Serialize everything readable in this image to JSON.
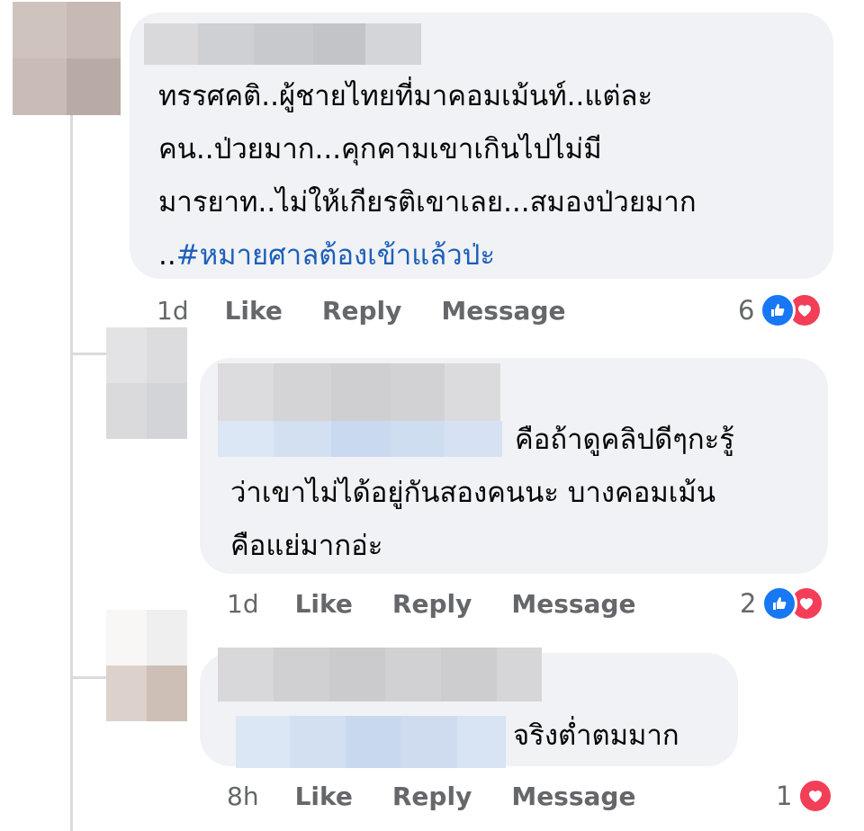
{
  "comments": [
    {
      "text": "ทรรศคติ..ผู้ชายไทยที่มาคอมเม้นท์..แต่ละ\nคน..ป่วยมาก...คุกคามเขาเกินไปไม่มี\nมารยาท..ไม่ให้เกียรติเขาเลย...สมองป่วยมาก\n..",
      "hashtag": "#หมายศาลต้องเข้าแล้วป่ะ",
      "time": "1d",
      "like": "Like",
      "reply": "Reply",
      "message": "Message",
      "reaction_count": "6",
      "reactions": [
        "like",
        "love"
      ]
    },
    {
      "text_line1": "คือถ้าดูคลิปดีๆกะรู้",
      "text_rest": "ว่าเขาไม่ได้อยู่กันสองคนนะ บางคอมเม้น\nคือแย่มากอ่ะ",
      "time": "1d",
      "like": "Like",
      "reply": "Reply",
      "message": "Message",
      "reaction_count": "2",
      "reactions": [
        "like",
        "love"
      ]
    },
    {
      "text": "จริงต่ำตมมาก",
      "time": "8h",
      "like": "Like",
      "reply": "Reply",
      "message": "Message",
      "reaction_count": "1",
      "reactions": [
        "love"
      ]
    }
  ],
  "colors": {
    "bubble": "#f0f2f5",
    "meta_text": "#65676b",
    "hashtag": "#1d5fb8",
    "like": "#1877f2",
    "love": "#f33e58"
  }
}
